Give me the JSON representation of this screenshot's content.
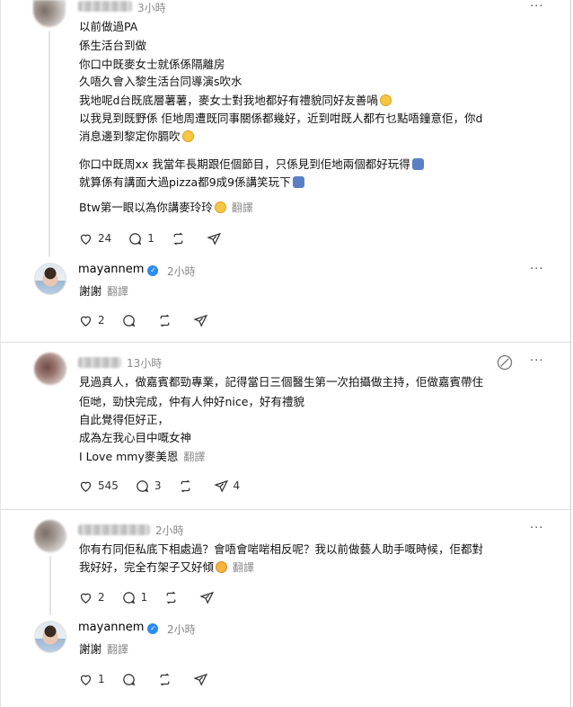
{
  "threads": [
    {
      "time": "3小時",
      "lines": [
        "以前做過PA",
        "係生活台到做",
        "你口中既麥女士就係係隔離房",
        "久唔久會入黎生活台同導演s吹水",
        "我地呢d台既底層薯薯，麥女士對我地都好有禮貌同好友善喎",
        "以我見到既野係 佢地周遭既同事關係都幾好，近到咁既人都冇乜點唔鐘意佢，你d",
        "消息邊到黎定你膈吹",
        "你口中既周xx 我當年長期跟佢個節目，只係見到佢地兩個都好玩得",
        "就算係有講面大過pizza都9成9係講笑玩下",
        "Btw第一眼以為你講麥玲玲"
      ],
      "translate": "翻譯",
      "likes": "24",
      "replies": "1"
    },
    {
      "user": "mayannem",
      "time": "2小時",
      "text": "謝謝",
      "translate": "翻譯",
      "likes": "2"
    },
    {
      "time": "13小時",
      "lines": [
        "見過真人，做嘉賓都勁專業，記得當日三個醫生第一次拍攝做主持，佢做嘉賓帶住",
        "佢哋，勁快完成，仲有人仲好nice，好有禮貌",
        "自此覺得佢好正，",
        "成為左我心目中嘅女神",
        "I Love mmy麥美恩"
      ],
      "translate": "翻譯",
      "likes": "545",
      "replies": "3",
      "reposts": "4"
    },
    {
      "time": "2小時",
      "lines": [
        "你有冇同佢私底下相處過？會唔會啱啱相反呢？我以前做藝人助手嘅時候，佢都對",
        "我好好，完全冇架子又好傾"
      ],
      "translate": "翻譯",
      "likes": "2",
      "replies": "1"
    },
    {
      "user": "mayannem",
      "time": "2小時",
      "text": "謝謝",
      "translate": "翻譯",
      "likes": "1"
    }
  ],
  "more_label": "···"
}
